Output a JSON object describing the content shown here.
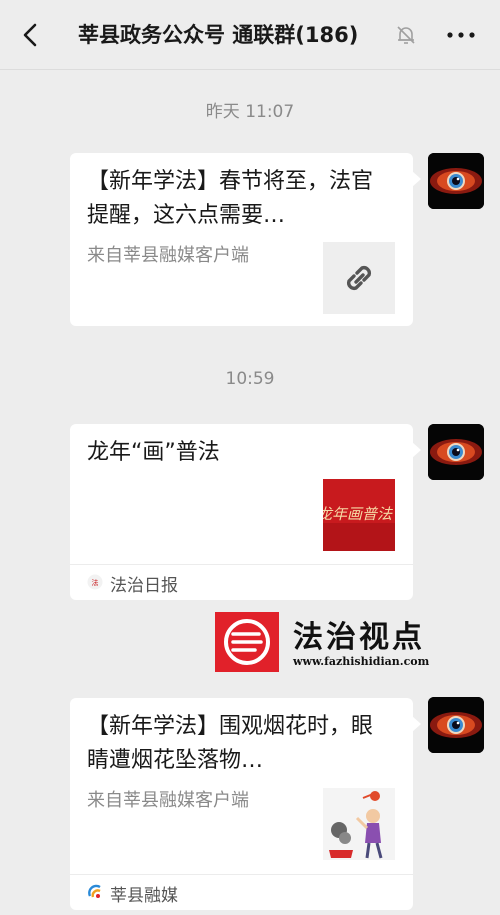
{
  "header": {
    "title": "莘县政务公众号 通联群(186)",
    "icons": [
      "back-arrow-icon",
      "bell-muted-icon",
      "more-icon"
    ]
  },
  "messages": [
    {
      "timestamp": "昨天 11:07",
      "title": "【新年学法】春节将至，法官提醒，这六点需要…",
      "source": "来自莘县融媒客户端",
      "thumbnail": "link-icon"
    },
    {
      "timestamp": "10:59",
      "title": "龙年“画”普法",
      "thumb_text": "龙年画普法",
      "footer": "法治日报"
    },
    {
      "title": "【新年学法】围观烟花时，眼睛遭烟花坠落物…",
      "source": "来自莘县融媒客户端",
      "footer": "莘县融媒"
    }
  ],
  "watermark": {
    "text": "法治视点",
    "url": "www.fazhishidian.com"
  },
  "colors": {
    "background": "#ededed",
    "bubble": "#ffffff",
    "muted_text": "#8a8a8a",
    "watermark_red": "#e1212a"
  }
}
